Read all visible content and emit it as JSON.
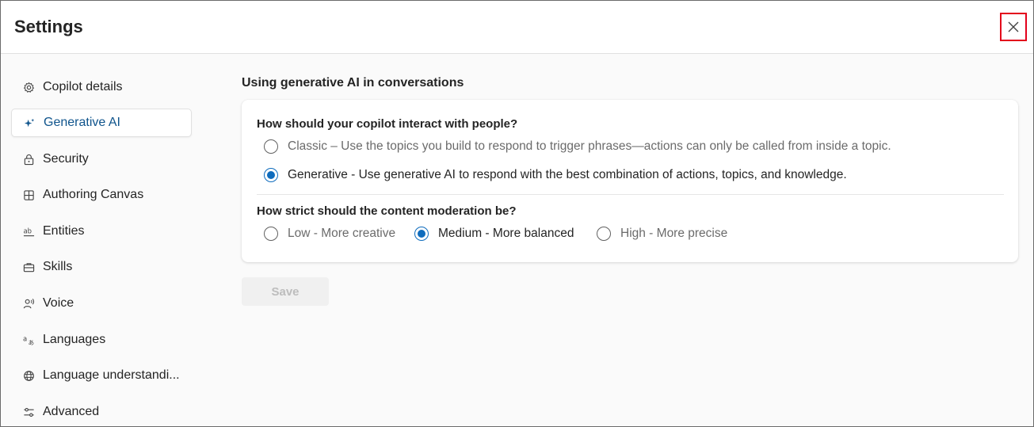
{
  "header": {
    "title": "Settings",
    "close_icon": "close-icon"
  },
  "sidebar": {
    "items": [
      {
        "label": "Copilot details",
        "icon": "gear-icon"
      },
      {
        "label": "Generative AI",
        "icon": "sparkle-icon",
        "active": true
      },
      {
        "label": "Security",
        "icon": "lock-icon"
      },
      {
        "label": "Authoring Canvas",
        "icon": "grid-icon"
      },
      {
        "label": "Entities",
        "icon": "entity-ab-icon"
      },
      {
        "label": "Skills",
        "icon": "briefcase-icon"
      },
      {
        "label": "Voice",
        "icon": "voice-person-icon"
      },
      {
        "label": "Languages",
        "icon": "translate-icon"
      },
      {
        "label": "Language understandi...",
        "icon": "globe-icon"
      },
      {
        "label": "Advanced",
        "icon": "sliders-icon"
      }
    ]
  },
  "main": {
    "section_title": "Using generative AI in conversations",
    "interaction": {
      "question": "How should your copilot interact with people?",
      "options": [
        {
          "label": "Classic – Use the topics you build to respond to trigger phrases—actions can only be called from inside a topic.",
          "checked": false
        },
        {
          "label": "Generative - Use generative AI to respond with the best combination of actions, topics, and knowledge.",
          "checked": true
        }
      ]
    },
    "moderation": {
      "question": "How strict should the content moderation be?",
      "options": [
        {
          "label": "Low - More creative",
          "checked": false
        },
        {
          "label": "Medium - More balanced",
          "checked": true
        },
        {
          "label": "High - More precise",
          "checked": false
        }
      ]
    },
    "save_label": "Save"
  },
  "colors": {
    "accent": "#0f6cbd",
    "active_text": "#0f548c",
    "close_highlight": "#e3001b"
  }
}
